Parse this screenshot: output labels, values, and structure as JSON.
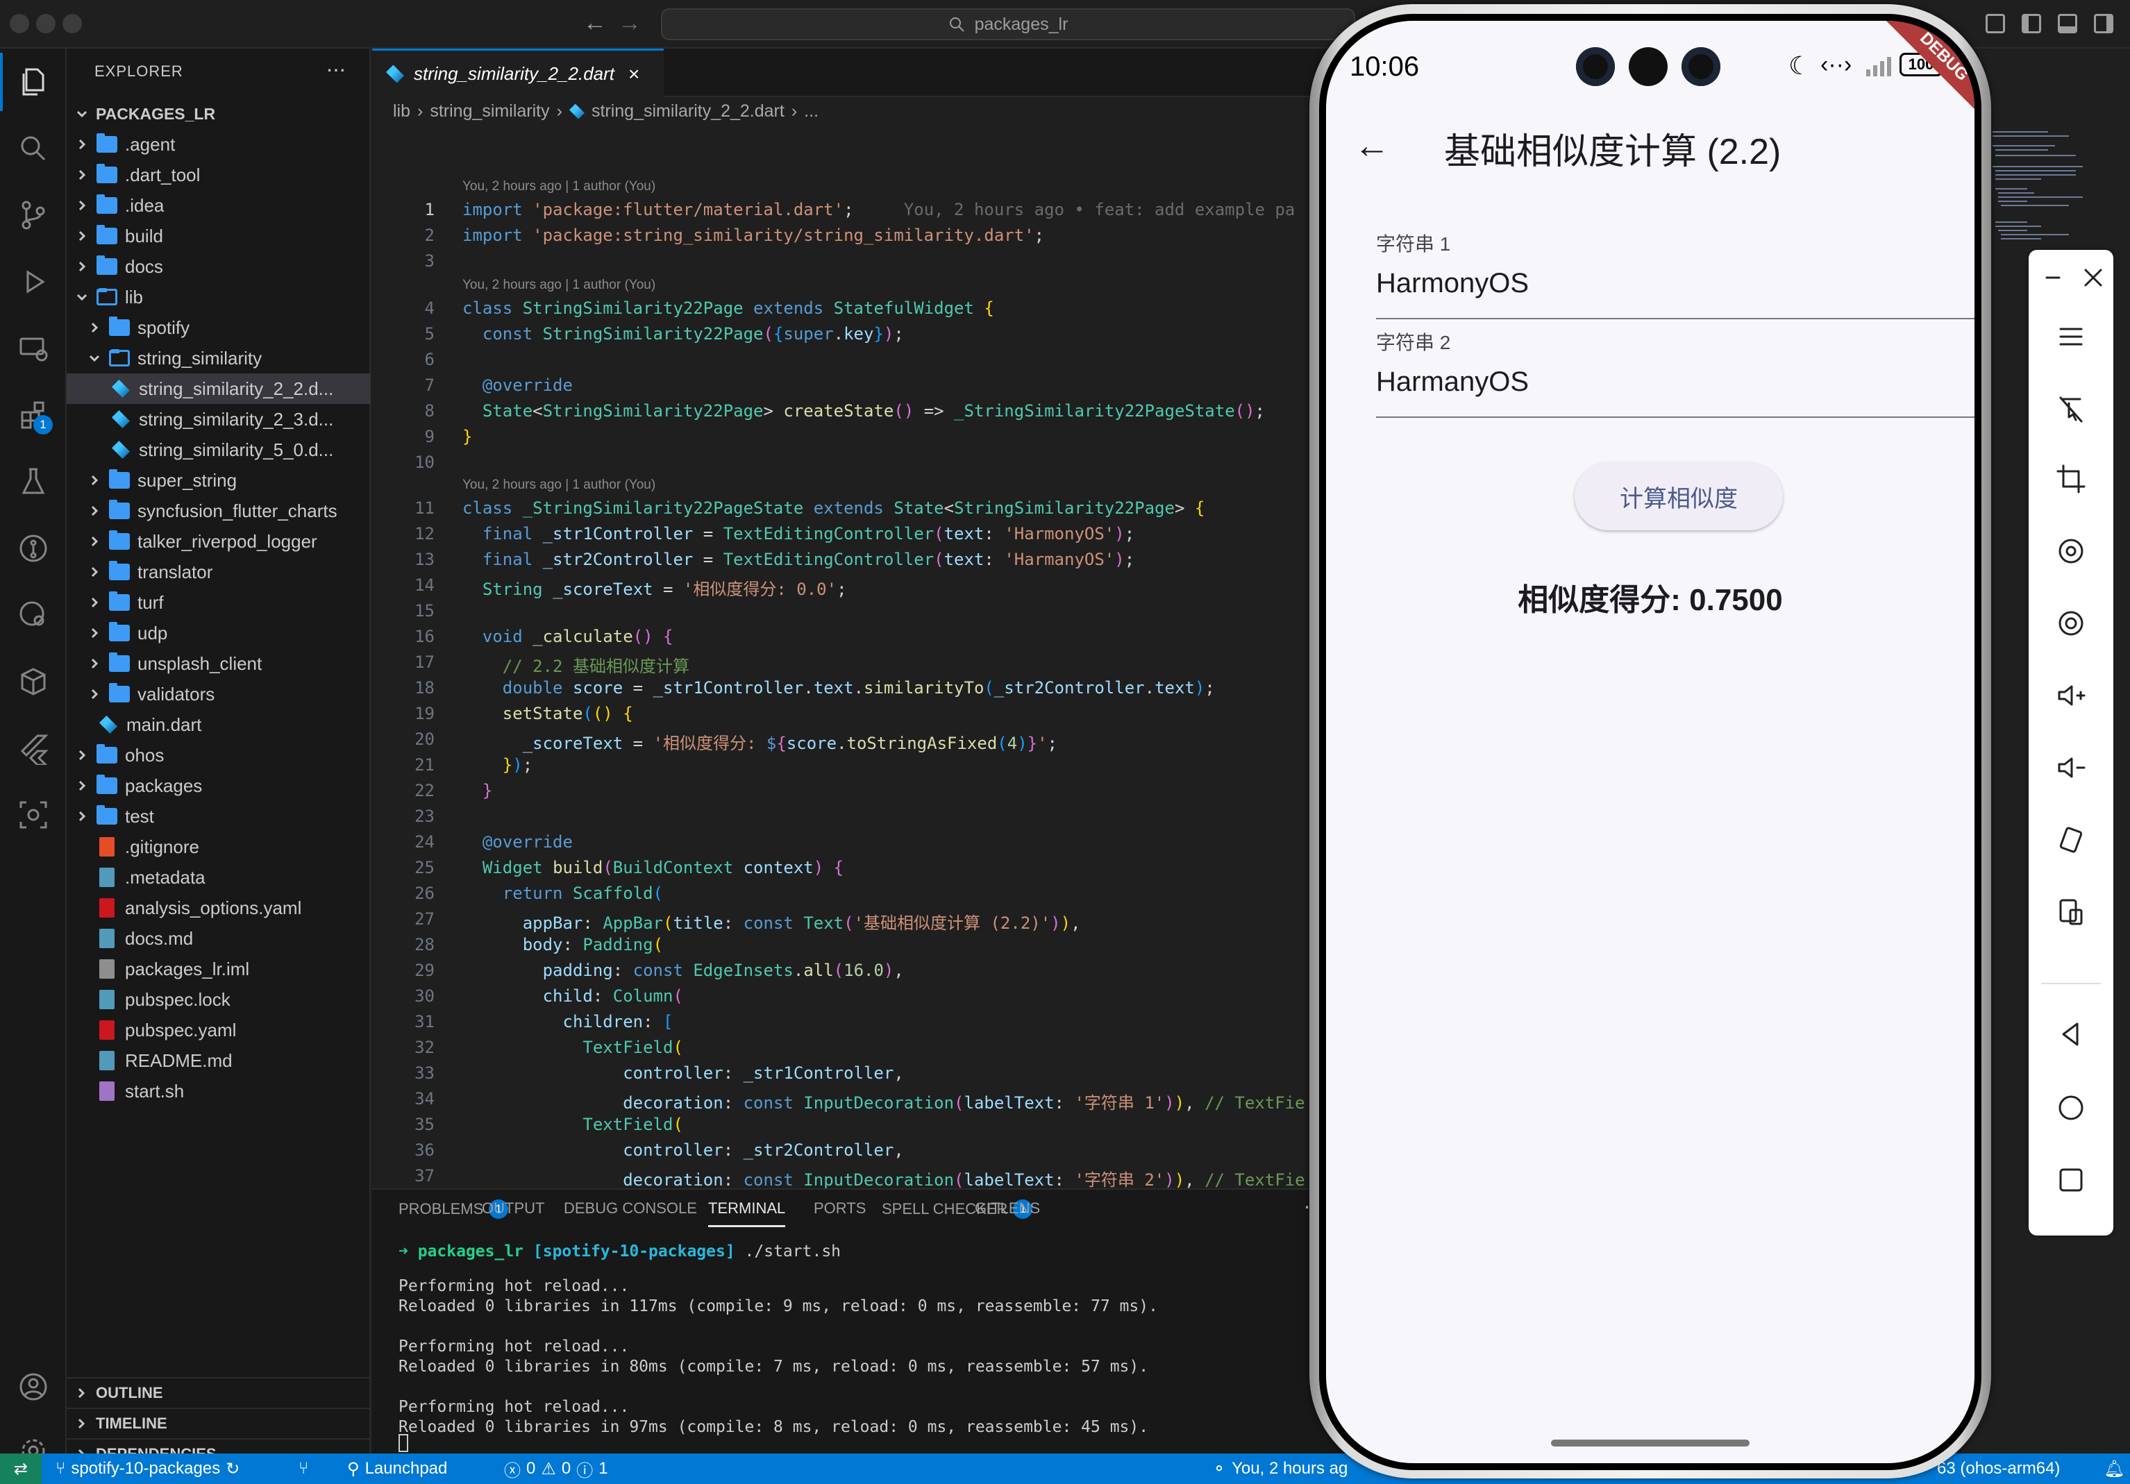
{
  "window": {
    "search": "packages_lr"
  },
  "explorer": {
    "title": "EXPLORER",
    "root": "PACKAGES_LR",
    "items": [
      {
        "label": ".agent",
        "kind": "folder",
        "depth": 1,
        "open": false
      },
      {
        "label": ".dart_tool",
        "kind": "folder",
        "depth": 1,
        "open": false
      },
      {
        "label": ".idea",
        "kind": "folder",
        "depth": 1,
        "open": false
      },
      {
        "label": "build",
        "kind": "folder",
        "depth": 1,
        "open": false
      },
      {
        "label": "docs",
        "kind": "folder",
        "depth": 1,
        "open": false
      },
      {
        "label": "lib",
        "kind": "folder",
        "depth": 1,
        "open": true
      },
      {
        "label": "spotify",
        "kind": "folder",
        "depth": 2,
        "open": false
      },
      {
        "label": "string_similarity",
        "kind": "folder",
        "depth": 2,
        "open": true
      },
      {
        "label": "string_similarity_2_2.d...",
        "kind": "dart",
        "depth": 3,
        "selected": true
      },
      {
        "label": "string_similarity_2_3.d...",
        "kind": "dart",
        "depth": 3
      },
      {
        "label": "string_similarity_5_0.d...",
        "kind": "dart",
        "depth": 3
      },
      {
        "label": "super_string",
        "kind": "folder",
        "depth": 2,
        "open": false
      },
      {
        "label": "syncfusion_flutter_charts",
        "kind": "folder",
        "depth": 2,
        "open": false
      },
      {
        "label": "talker_riverpod_logger",
        "kind": "folder",
        "depth": 2,
        "open": false
      },
      {
        "label": "translator",
        "kind": "folder",
        "depth": 2,
        "open": false
      },
      {
        "label": "turf",
        "kind": "folder",
        "depth": 2,
        "open": false
      },
      {
        "label": "udp",
        "kind": "folder",
        "depth": 2,
        "open": false
      },
      {
        "label": "unsplash_client",
        "kind": "folder",
        "depth": 2,
        "open": false
      },
      {
        "label": "validators",
        "kind": "folder",
        "depth": 2,
        "open": false
      },
      {
        "label": "main.dart",
        "kind": "dart",
        "depth": 2
      },
      {
        "label": "ohos",
        "kind": "folder",
        "depth": 1,
        "open": false
      },
      {
        "label": "packages",
        "kind": "folder",
        "depth": 1,
        "open": false
      },
      {
        "label": "test",
        "kind": "folder",
        "depth": 1,
        "open": false
      },
      {
        "label": ".gitignore",
        "kind": "file",
        "depth": 1,
        "color": "#e44d26"
      },
      {
        "label": ".metadata",
        "kind": "file",
        "depth": 1,
        "color": "#519aba"
      },
      {
        "label": "analysis_options.yaml",
        "kind": "file",
        "depth": 1,
        "color": "#cb171e"
      },
      {
        "label": "docs.md",
        "kind": "file",
        "depth": 1,
        "color": "#519aba"
      },
      {
        "label": "packages_lr.iml",
        "kind": "file",
        "depth": 1,
        "color": "#8e8e8e"
      },
      {
        "label": "pubspec.lock",
        "kind": "file",
        "depth": 1,
        "color": "#519aba"
      },
      {
        "label": "pubspec.yaml",
        "kind": "file",
        "depth": 1,
        "color": "#cb171e"
      },
      {
        "label": "README.md",
        "kind": "file",
        "depth": 1,
        "color": "#519aba"
      },
      {
        "label": "start.sh",
        "kind": "file",
        "depth": 1,
        "color": "#a074c4"
      }
    ],
    "sections": [
      "OUTLINE",
      "TIMELINE",
      "DEPENDENCIES"
    ]
  },
  "editor": {
    "tab": "string_similarity_2_2.dart",
    "breadcrumb": [
      "lib",
      "string_similarity",
      "string_similarity_2_2.dart",
      "..."
    ],
    "blame": "You, 2 hours ago | 1 author (You)",
    "inline_blame": "You, 2 hours ago • feat: add example pa",
    "current_line": 1
  },
  "panel": {
    "tabs": [
      {
        "label": "PROBLEMS",
        "badge": "1"
      },
      {
        "label": "OUTPUT"
      },
      {
        "label": "DEBUG CONSOLE"
      },
      {
        "label": "TERMINAL",
        "active": true
      },
      {
        "label": "PORTS"
      },
      {
        "label": "SPELL CHECKER",
        "badge": "1"
      },
      {
        "label": "GITLENS"
      }
    ],
    "prompt_dir": "packages_lr",
    "prompt_branch": "[spotify-10-packages]",
    "prompt_cmd": "./start.sh",
    "lines": [
      "Performing hot reload...",
      "Reloaded 0 libraries in 117ms (compile: 9 ms, reload: 0 ms, reassemble: 77 ms).",
      "",
      "Performing hot reload...",
      "Reloaded 0 libraries in 80ms (compile: 7 ms, reload: 0 ms, reassemble: 57 ms).",
      "",
      "Performing hot reload...",
      "Reloaded 0 libraries in 97ms (compile: 8 ms, reload: 0 ms, reassemble: 45 ms)."
    ]
  },
  "statusbar": {
    "branch": "spotify-10-packages",
    "launchpad": "Launchpad",
    "errors": "0",
    "warnings": "0",
    "info": "1",
    "blame": "You, 2 hours ag",
    "device": "63 (ohos-arm64)"
  },
  "phone": {
    "time": "10:06",
    "battery": "100",
    "debug_banner": "DEBUG",
    "appbar_title": "基础相似度计算 (2.2)",
    "field1_label": "字符串 1",
    "field1_value": "HarmonyOS",
    "field2_label": "字符串 2",
    "field2_value": "HarmanyOS",
    "button": "计算相似度",
    "result": "相似度得分: 0.7500"
  }
}
